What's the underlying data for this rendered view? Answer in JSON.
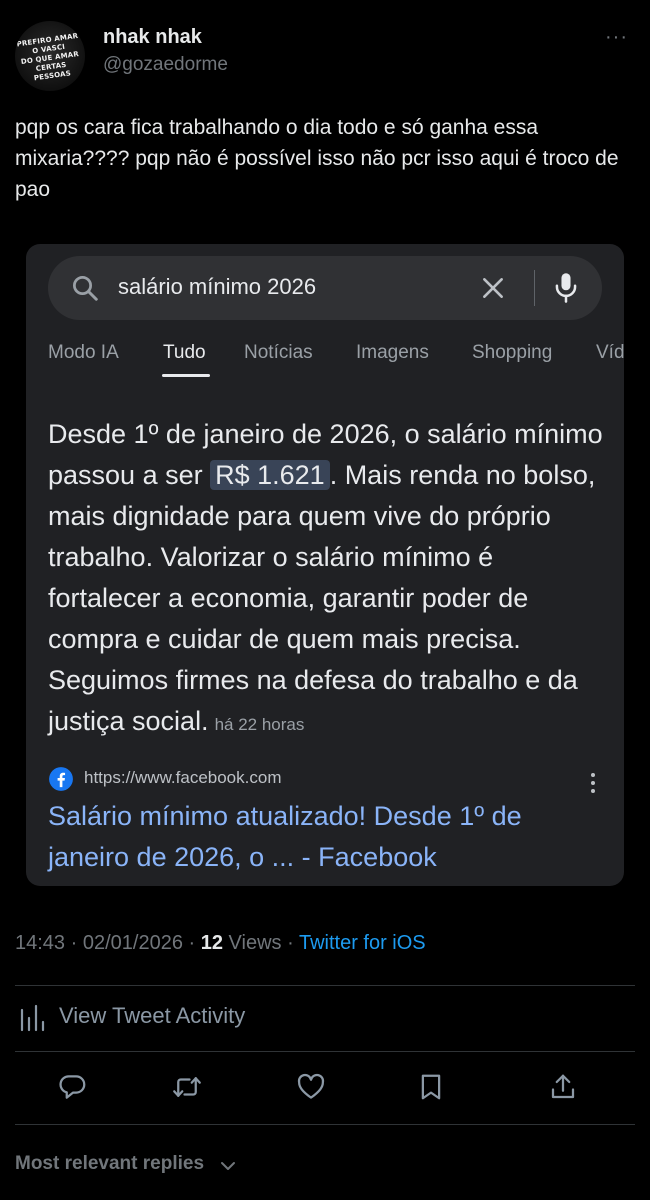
{
  "user": {
    "display_name": "nhak nhak",
    "handle": "@gozaedorme",
    "avatar_text": "PREFIRO AMAR\nO VASCI\nDO QUE AMAR\nCERTAS PESSOAS"
  },
  "more_menu_label": "···",
  "tweet_text": "pqp os cara fica trabalhando o dia todo e só ganha essa mixaria???? pqp não é possível isso não pcr isso aqui é troco de pao",
  "embedded_search": {
    "query": "salário mínimo 2026",
    "tabs": [
      {
        "label": "Modo IA",
        "active": false
      },
      {
        "label": "Tudo",
        "active": true
      },
      {
        "label": "Notícias",
        "active": false
      },
      {
        "label": "Imagens",
        "active": false
      },
      {
        "label": "Shopping",
        "active": false
      },
      {
        "label": "Víd",
        "active": false
      }
    ],
    "answer_before": "Desde 1º de janeiro de 2026, o salário mínimo passou a ser ",
    "answer_highlight": "R$ 1.621",
    "answer_after": ". Mais renda no bolso, mais dignidade para quem vive do próprio trabalho. Valorizar o salário mínimo é fortalecer a economia, garantir poder de compra e cuidar de quem mais precisa. Seguimos firmes na defesa do trabalho e da justiça social.",
    "answer_time": "há 22 horas",
    "source_url": "https://www.facebook.com",
    "result_title": "Salário mínimo atualizado! Desde 1º de janeiro de 2026, o ... - Facebook"
  },
  "meta": {
    "time": "14:43",
    "separator": " · ",
    "date": "02/01/2026",
    "views_count": "12",
    "views_label": " Views",
    "source": "Twitter for iOS"
  },
  "activity_label": "View Tweet Activity",
  "replies_label": "Most relevant replies",
  "colors": {
    "background": "#000000",
    "text_primary": "#e7e9ea",
    "text_secondary": "#71767b",
    "link_blue": "#1d9bf0",
    "card_background": "#202124",
    "search_result_link": "#8ab4f8",
    "highlight": "#394457"
  },
  "icons": [
    "search-icon",
    "clear-icon",
    "mic-icon",
    "facebook-icon",
    "kebab-icon",
    "activity-chart-icon",
    "reply-icon",
    "retweet-icon",
    "like-icon",
    "bookmark-icon",
    "share-icon",
    "chevron-down-icon"
  ]
}
